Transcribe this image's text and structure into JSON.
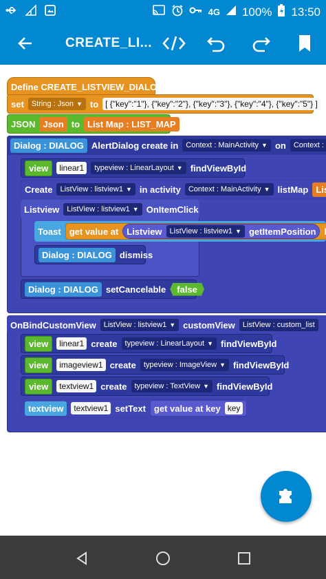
{
  "status_bar": {
    "network": "4G",
    "battery": "100%",
    "time": "13:50"
  },
  "app_bar": {
    "title": "CREATE_LI...",
    "icons": [
      "back-arrow-icon",
      "code-icon",
      "undo-icon",
      "redo-icon",
      "bookmark-icon"
    ]
  },
  "blocks": {
    "define": "Define CREATE_LISTVIEW_DIALOG",
    "set": {
      "label": "set",
      "type": "String : Json",
      "to": "to",
      "value": "[ {\"key\":\"1\"}, {\"key\":\"2\"}, {\"key\":\"3\"}, {\"key\":\"4\"}, {\"key\":\"5\"} ]"
    },
    "json": {
      "label": "JSON",
      "var": "Json",
      "to": "to",
      "target": "List Map : LIST_MAP"
    },
    "dialog": {
      "tag": "Dialog : DIALOG",
      "text": "AlertDialog create in",
      "context": "Context : MainActivity",
      "on": "on",
      "context2": "Context : MainActiv"
    },
    "view_linear": {
      "label": "view",
      "name": "linear1",
      "type": "typeview : LinearLayout",
      "method": "findViewById"
    },
    "create": {
      "label": "Create",
      "listview": "ListView : listview1",
      "in": "in activity",
      "context": "Context : MainActivity",
      "listmap": "listMap",
      "tail": "Lis"
    },
    "listview": {
      "label": "Listview",
      "type": "ListView : listview1",
      "event": "OnItemClick"
    },
    "toast": {
      "label": "Toast",
      "getvalue": "get value at",
      "listview": "Listview",
      "type": "ListView : listview1",
      "method": "getItemPosition",
      "tail": "ke"
    },
    "dismiss": {
      "tag": "Dialog : DIALOG",
      "text": "dismiss"
    },
    "cancelable": {
      "tag": "Dialog : DIALOG",
      "text": "setCancelable",
      "value": "false"
    },
    "onbind": {
      "label": "OnBindCustomView",
      "type": "ListView : listview1",
      "custom": "customView",
      "type2": "ListView : custom_list"
    },
    "bind_rows": [
      {
        "label": "view",
        "name": "linear1",
        "create": "create",
        "type": "typeview : LinearLayout",
        "method": "findViewById"
      },
      {
        "label": "view",
        "name": "imageview1",
        "create": "create",
        "type": "typeview : ImageView",
        "method": "findViewById"
      },
      {
        "label": "view",
        "name": "textview1",
        "create": "create",
        "type": "typeview : TextView",
        "method": "findViewById"
      }
    ],
    "settext": {
      "label": "textview",
      "name": "textview1",
      "method": "setText",
      "getkey": "get value at key",
      "key": "key"
    }
  }
}
